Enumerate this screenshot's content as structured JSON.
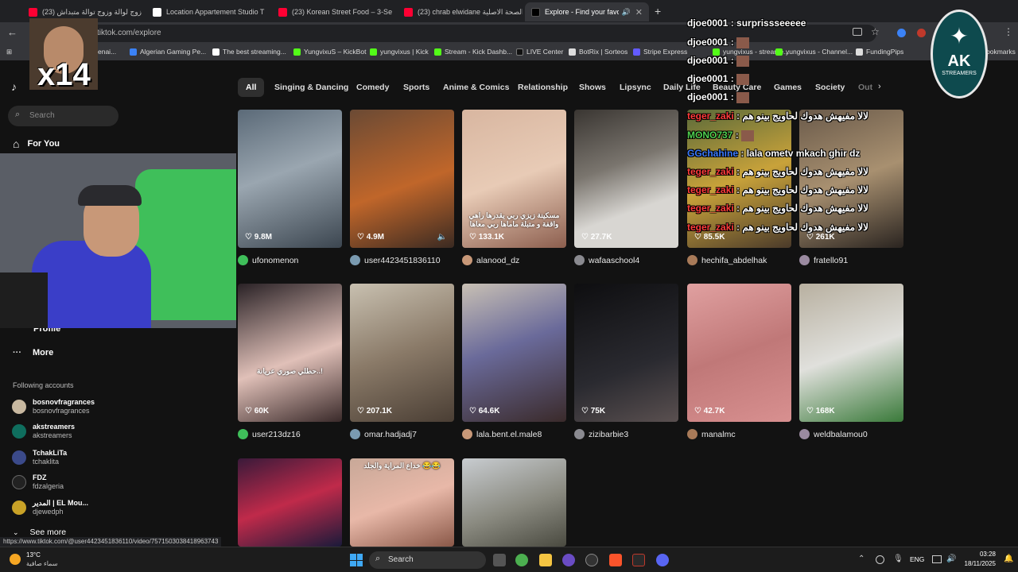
{
  "tabs": [
    {
      "label": "(23) زوج لوالة وزوج توالة متبداش",
      "color": "#ff0033"
    },
    {
      "label": "Location Appartement Studio T",
      "color": "#ffffff"
    },
    {
      "label": "(23) Korean Street Food – 3-Se",
      "color": "#ff0033"
    },
    {
      "label": "(23) chrab elwidane الصحة الاصلية",
      "color": "#ff0033"
    },
    {
      "label": "Explore - Find your favourite",
      "color": "#111111"
    }
  ],
  "address": {
    "url": "tiktok.com/explore"
  },
  "bookmarks": [
    "Algerian Gaming Pe...",
    "The best streaming...",
    "YungvixuS – KickBot",
    "yungvixus | Kick",
    "Stream - Kick Dashb...",
    "LIVE Center",
    "BotRix | Sorteos",
    "Stripe Express",
    "yungvixus - streame...",
    "yungvixus - Channel...",
    "FundingPips"
  ],
  "bookmarks_tail": "bokmarks",
  "sidebar": {
    "search_placeholder": "Search",
    "for_you": "For You",
    "profile": "Profile",
    "more": "More",
    "following_header": "Following accounts",
    "accounts": [
      {
        "name": "bosnovfragrances",
        "handle": "bosnovfragrances",
        "color": "#c8b8a0"
      },
      {
        "name": "akstreamers",
        "handle": "akstreamers",
        "color": "#0f6e5e"
      },
      {
        "name": "TchakLiTa",
        "handle": "tchaklita",
        "color": "#3b4a8a"
      },
      {
        "name": "FDZ",
        "handle": "fdzalgeria",
        "color": "#222222"
      },
      {
        "name": "المدير | EL Mou...",
        "handle": "djewedph",
        "color": "#c9a227"
      }
    ],
    "see_more": "See more"
  },
  "categories": [
    "All",
    "Singing & Dancing",
    "Comedy",
    "Sports",
    "Anime & Comics",
    "Relationship",
    "Shows",
    "Lipsync",
    "Daily Life",
    "Beauty Care",
    "Games",
    "Society",
    "Out"
  ],
  "videos": [
    {
      "likes": "9.8M",
      "author": "ufonomenon",
      "bg": "linear-gradient(160deg,#5b6a78,#9aa6b0 45%,#3c4650)"
    },
    {
      "likes": "4.9M",
      "author": "user4423451836110",
      "bg": "linear-gradient(160deg,#6b4a34,#c0662a 55%,#3a2a22)"
    },
    {
      "likes": "133.1K",
      "author": "alanood_dz",
      "bg": "linear-gradient(160deg,#d8b6a0,#e8cbb6 50%,#8c5e4e)",
      "overlay": "مسكينة زيزي ربي يقدرها راهي واقفة و متبلة ماماها ربي معاها"
    },
    {
      "likes": "27.7K",
      "author": "wafaaschool4",
      "bg": "linear-gradient(160deg,#3a3632,#7a756e 40%,#d8d6d2 70%)"
    },
    {
      "likes": "85.5K",
      "author": "hechifa_abdelhak",
      "bg": "linear-gradient(160deg,#5a6a3a,#c8a23a 50%,#4a3a2a)"
    },
    {
      "likes": "261K",
      "author": "fratello91",
      "bg": "linear-gradient(160deg,#6a5a4a,#a89070 50%,#2a2420)"
    },
    {
      "likes": "60K",
      "author": "user213dz16",
      "bg": "linear-gradient(160deg,#2a2226,#e0c0b8 55%,#3a2a2a)",
      "overlay": "حطلي صوري عريانة..!"
    },
    {
      "likes": "207.1K",
      "author": "omar.hadjadj7",
      "bg": "linear-gradient(160deg,#c8c0b0,#8a7a68 50%,#4a3e34)"
    },
    {
      "likes": "64.6K",
      "author": "lala.bent.el.male8",
      "bg": "linear-gradient(160deg,#c8c0b4,#6a6a9a 45%,#3a2a2a)"
    },
    {
      "likes": "75K",
      "author": "zizibarbie3",
      "bg": "linear-gradient(160deg,#0e0e10,#2a2a30 60%,#5a5050)"
    },
    {
      "likes": "42.7K",
      "author": "manalmc",
      "bg": "linear-gradient(160deg,#e0a0a0,#c07878 50%,#d89090)"
    },
    {
      "likes": "168K",
      "author": "weldbalamou0",
      "bg": "linear-gradient(160deg,#b8b0a0,#e0e0dc 50%,#3a7a3a)"
    },
    {
      "likes": "",
      "author": "",
      "bg": "linear-gradient(160deg,#3a1a3a,#c02a4a 50%,#1a1a3a)"
    },
    {
      "likes": "",
      "author": "",
      "bg": "linear-gradient(160deg,#c8a898,#e8b8a8 50%,#8a5848)",
      "overlay": "خداع المراية والجلد 😂😂"
    },
    {
      "likes": "",
      "author": "",
      "bg": "linear-gradient(160deg,#c8ccd0,#8a8a80 55%,#4a4a40)"
    }
  ],
  "chat": [
    {
      "user": "djoe0001",
      "text": "surprissseeeee",
      "color": "#ffffff"
    },
    {
      "user": "djoe0001",
      "text": "",
      "color": "#ffffff"
    },
    {
      "user": "djoe0001",
      "text": "",
      "color": "#ffffff"
    },
    {
      "user": "djoe0001",
      "text": "",
      "color": "#ffffff"
    },
    {
      "user": "djoe0001",
      "text": "",
      "color": "#ffffff"
    },
    {
      "user": "teger_zaki",
      "text": "لالا مفيهش هدوك لحاويج بينو هم",
      "color": "#ff3b3b"
    },
    {
      "user": "MONO737",
      "text": "",
      "color": "#4fd04f"
    },
    {
      "user": "GGchahine",
      "text": "lala ometv mkach ghir dz",
      "color": "#3b7bff"
    },
    {
      "user": "teger_zaki",
      "text": "لالا مفيهش هدوك لحاويج بينو هم",
      "color": "#ff3b3b"
    },
    {
      "user": "teger_zaki",
      "text": "لالا مفيهش هدوك لحاويج بينو هم",
      "color": "#ff3b3b"
    },
    {
      "user": "teger_zaki",
      "text": "لالا مفيهش هدوك لحاويج بينو هم",
      "color": "#ff3b3b"
    },
    {
      "user": "teger_zaki",
      "text": "لالا مفيهش هدوك لحاويج بينو هم",
      "color": "#ff3b3b"
    }
  ],
  "emote_count": "x14",
  "badge": {
    "letters": "AK",
    "sub": "STREAMERS"
  },
  "status_url": "https://www.tiktok.com/@user4423451836110/video/7571503038418963743",
  "weather": {
    "temp": "13°C",
    "desc": "سماء صافية"
  },
  "taskbar": {
    "search": "Search",
    "lang": "ENG",
    "time": "03:28",
    "date": "18/11/2025"
  }
}
